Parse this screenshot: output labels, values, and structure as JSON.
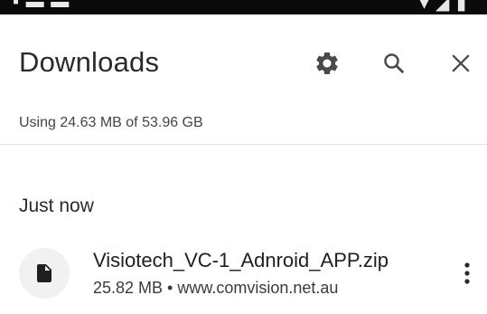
{
  "header": {
    "title": "Downloads",
    "settings_icon": "gear-icon",
    "search_icon": "search-icon",
    "close_icon": "close-icon"
  },
  "storage": {
    "text": "Using 24.63 MB of 53.96 GB"
  },
  "section": {
    "label": "Just now"
  },
  "downloads": [
    {
      "name": "Visiotech_VC-1_Adnroid_APP.zip",
      "meta": "25.82 MB • www.comvision.net.au",
      "icon": "file-icon",
      "menu_icon": "more-vert-icon"
    }
  ],
  "colors": {
    "text_primary": "#202020",
    "text_secondary": "#444444",
    "icon": "#4a4a4a",
    "status_bar": "#0a0a0a",
    "divider": "#e2e2e2"
  }
}
